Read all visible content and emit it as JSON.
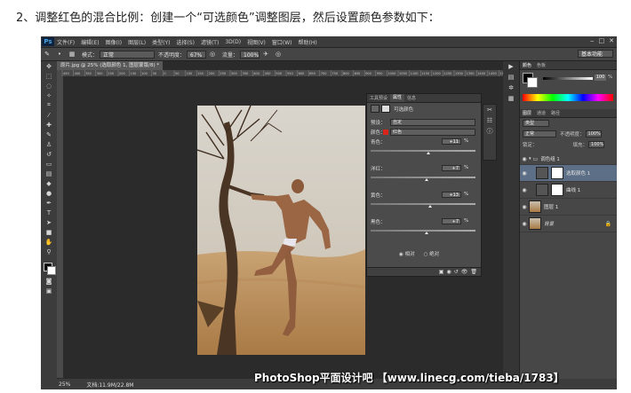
{
  "caption": "2、调整红色的混合比例：创建一个“可选颜色”调整图层，然后设置颜色参数如下：",
  "app": {
    "logo": "Ps",
    "menu": [
      "文件(F)",
      "编辑(E)",
      "图像(I)",
      "图层(L)",
      "类型(Y)",
      "选择(S)",
      "滤镜(T)",
      "3D(D)",
      "视图(V)",
      "窗口(W)",
      "帮助(H)"
    ],
    "window_controls": [
      "‒",
      "□",
      "✕"
    ],
    "options": {
      "mode_label": "模式：",
      "mode_value": "正常",
      "opacity_label": "不透明度：",
      "opacity_value": "67%",
      "flow_label": "流量：",
      "flow_value": "100%",
      "workspace": "基本功能"
    },
    "document_tab": "原片.jpg @ 25% (选取颜色 1, 图层蒙版/8) *",
    "ruler_ticks": [
      "450",
      "400",
      "350",
      "300",
      "250",
      "200",
      "150",
      "100",
      "50",
      "0",
      "50",
      "100",
      "150",
      "200",
      "250",
      "300",
      "350",
      "400",
      "450",
      "500",
      "550",
      "600",
      "650",
      "700",
      "750",
      "800",
      "850",
      "900",
      "950",
      "1000",
      "1050",
      "1100",
      "1150",
      "1200",
      "1250",
      "1300",
      "1350",
      "1400",
      "1450",
      "1500"
    ],
    "status": {
      "zoom": "25%",
      "doc": "文档:11.9M/22.8M"
    },
    "properties": {
      "tabs": [
        "工具预设",
        "属性",
        "信息"
      ],
      "active_tab": "属性",
      "title": "可选颜色",
      "preset_label": "预设：",
      "preset_value": "自定",
      "color_label": "颜色：",
      "color_value": "红色",
      "sliders": [
        {
          "label": "青色：",
          "value": "+11",
          "fraction": 0.555
        },
        {
          "label": "洋红：",
          "value": "+7",
          "fraction": 0.535
        },
        {
          "label": "黄色：",
          "value": "+13",
          "fraction": 0.565
        },
        {
          "label": "黑色：",
          "value": "+7",
          "fraction": 0.535
        }
      ],
      "pct": "%",
      "radio_relative": "相对",
      "radio_absolute": "绝对"
    },
    "color_panel": {
      "tabs": [
        "颜色",
        "色板"
      ],
      "value": "100",
      "pct": "%"
    },
    "layers_panel": {
      "tabs": [
        "图层",
        "通道",
        "路径"
      ],
      "filter_label": "类型",
      "blend_mode": "正常",
      "opacity_label": "不透明度：",
      "opacity_value": "100%",
      "lock_label": "锁定：",
      "fill_label": "填充：",
      "fill_value": "100%",
      "layers": [
        {
          "name": "调色组 1"
        },
        {
          "name": "选取颜色 1"
        },
        {
          "name": "曲线 1"
        },
        {
          "name": "图层 1"
        },
        {
          "name": "背景"
        }
      ]
    },
    "watermark": "PhotoShop平面设计吧 【www.linecg.com/tieba/1783】"
  }
}
